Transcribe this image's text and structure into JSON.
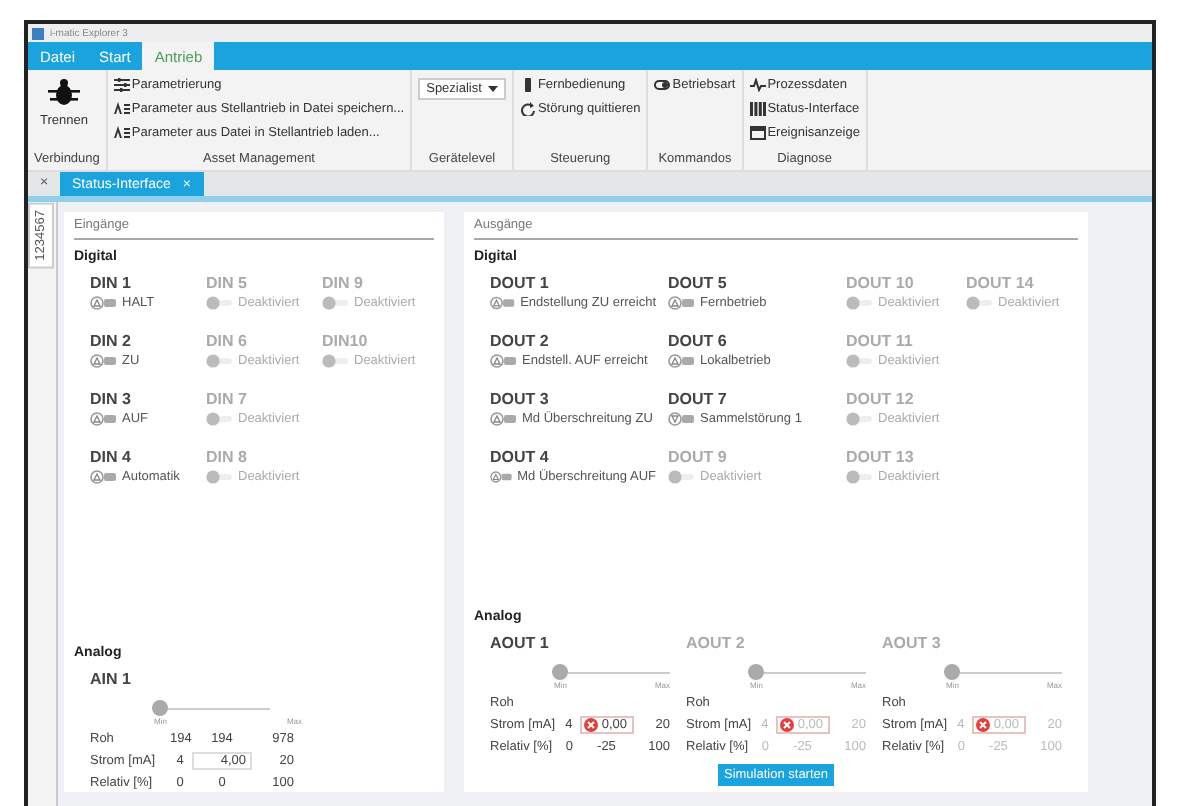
{
  "window": {
    "title": "i-matic Explorer 3"
  },
  "menu": [
    {
      "label": "Datei",
      "selected": false
    },
    {
      "label": "Start",
      "selected": false
    },
    {
      "label": "Antrieb",
      "selected": true
    }
  ],
  "ribbon": [
    {
      "label": "Verbindung",
      "items": [
        {
          "kind": "big",
          "label": "Trennen"
        }
      ]
    },
    {
      "label": "Asset Management",
      "items": [
        {
          "kind": "small",
          "label": "Parametrierung"
        },
        {
          "kind": "small",
          "label": "Parameter aus Stellantrieb in Datei speichern..."
        },
        {
          "kind": "small",
          "label": "Parameter aus Datei in Stellantrieb laden..."
        }
      ]
    },
    {
      "label": "Gerätelevel",
      "items": [
        {
          "kind": "dropdown",
          "label": "Spezialist"
        }
      ]
    },
    {
      "label": "Steuerung",
      "items": [
        {
          "kind": "small",
          "label": "Fernbedienung"
        },
        {
          "kind": "small",
          "label": "Störung quittieren"
        }
      ]
    },
    {
      "label": "Kommandos",
      "items": [
        {
          "kind": "small",
          "label": "Betriebsart"
        }
      ]
    },
    {
      "label": "Diagnose",
      "items": [
        {
          "kind": "small",
          "label": "Prozessdaten"
        },
        {
          "kind": "small",
          "label": "Status-Interface"
        },
        {
          "kind": "small",
          "label": "Ereignisanzeige"
        }
      ]
    }
  ],
  "side_close": "×",
  "doc_tab": {
    "label": "Status-Interface",
    "close": "×"
  },
  "side_label": "1234567",
  "inputs": {
    "title": "Eingänge",
    "digital_title": "Digital",
    "digital": [
      [
        {
          "name": "DIN 1",
          "label": "HALT",
          "enabled": true,
          "triggered": false
        },
        {
          "name": "DIN 2",
          "label": "ZU",
          "enabled": true,
          "triggered": false
        },
        {
          "name": "DIN 3",
          "label": "AUF",
          "enabled": true,
          "triggered": false
        },
        {
          "name": "DIN 4",
          "label": "Automatik",
          "enabled": true,
          "triggered": false
        }
      ],
      [
        {
          "name": "DIN 5",
          "label": "Deaktiviert",
          "enabled": false
        },
        {
          "name": "DIN 6",
          "label": "Deaktiviert",
          "enabled": false
        },
        {
          "name": "DIN 7",
          "label": "Deaktiviert",
          "enabled": false
        },
        {
          "name": "DIN 8",
          "label": "Deaktiviert",
          "enabled": false
        }
      ],
      [
        {
          "name": "DIN 9",
          "label": "Deaktiviert",
          "enabled": false
        },
        {
          "name": "DIN10",
          "label": "Deaktiviert",
          "enabled": false
        }
      ]
    ],
    "analog_title": "Analog",
    "analog": [
      {
        "name": "AIN 1",
        "enabled": true,
        "level": 0,
        "min": "Min",
        "max": "Max",
        "rows": [
          {
            "label": "Roh",
            "min": "194",
            "value": "194",
            "max": "978",
            "kind": "text"
          },
          {
            "label": "Strom [mA]",
            "min": "4",
            "value": "4,00",
            "max": "20",
            "kind": "field",
            "error": false
          },
          {
            "label": "Relativ [%]",
            "min": "0",
            "value": "0",
            "max": "100",
            "kind": "text"
          }
        ]
      }
    ]
  },
  "outputs": {
    "title": "Ausgänge",
    "digital_title": "Digital",
    "digital": [
      [
        {
          "name": "DOUT 1",
          "label": "Endstellung ZU erreicht",
          "enabled": true,
          "triggered": false
        },
        {
          "name": "DOUT 2",
          "label": "Endstell. AUF erreicht",
          "enabled": true,
          "triggered": false
        },
        {
          "name": "DOUT 3",
          "label": "Md Überschreitung ZU",
          "enabled": true,
          "triggered": false
        },
        {
          "name": "DOUT 4",
          "label": "Md Überschreitung AUF",
          "enabled": true,
          "triggered": false
        }
      ],
      [
        {
          "name": "DOUT 5",
          "label": "Fernbetrieb",
          "enabled": true,
          "triggered": false
        },
        {
          "name": "DOUT 6",
          "label": "Lokalbetrieb",
          "enabled": true,
          "triggered": false
        },
        {
          "name": "DOUT 7",
          "label": "Sammelstörung 1",
          "enabled": true,
          "triggered": true
        },
        {
          "name": "DOUT 9",
          "label": "Deaktiviert",
          "enabled": false
        }
      ],
      [
        {
          "name": "DOUT 10",
          "label": "Deaktiviert",
          "enabled": false
        },
        {
          "name": "DOUT 11",
          "label": "Deaktiviert",
          "enabled": false
        },
        {
          "name": "DOUT 12",
          "label": "Deaktiviert",
          "enabled": false
        },
        {
          "name": "DOUT 13",
          "label": "Deaktiviert",
          "enabled": false
        }
      ],
      [
        {
          "name": "DOUT 14",
          "label": "Deaktiviert",
          "enabled": false
        }
      ]
    ],
    "analog_title": "Analog",
    "analog": [
      {
        "name": "AOUT 1",
        "enabled": true,
        "level": 0,
        "min": "Min",
        "max": "Max",
        "rows": [
          {
            "label": "Roh",
            "kind": "label"
          },
          {
            "label": "Strom [mA]",
            "min": "4",
            "value": "0,00",
            "max": "20",
            "kind": "field",
            "error": true
          },
          {
            "label": "Relativ [%]",
            "min": "0",
            "value": "-25",
            "max": "100",
            "kind": "text"
          }
        ]
      },
      {
        "name": "AOUT 2",
        "enabled": false,
        "level": 0,
        "min": "Min",
        "max": "Max",
        "rows": [
          {
            "label": "Roh",
            "kind": "label"
          },
          {
            "label": "Strom [mA]",
            "min": "4",
            "value": "0,00",
            "max": "20",
            "kind": "field",
            "error": true
          },
          {
            "label": "Relativ [%]",
            "min": "0",
            "value": "-25",
            "max": "100",
            "kind": "text"
          }
        ]
      },
      {
        "name": "AOUT 3",
        "enabled": false,
        "level": 0,
        "min": "Min",
        "max": "Max",
        "rows": [
          {
            "label": "Roh",
            "kind": "label"
          },
          {
            "label": "Strom [mA]",
            "min": "4",
            "value": "0,00",
            "max": "20",
            "kind": "field",
            "error": true
          },
          {
            "label": "Relativ [%]",
            "min": "0",
            "value": "-25",
            "max": "100",
            "kind": "text"
          }
        ]
      }
    ],
    "button": "Simulation starten"
  }
}
